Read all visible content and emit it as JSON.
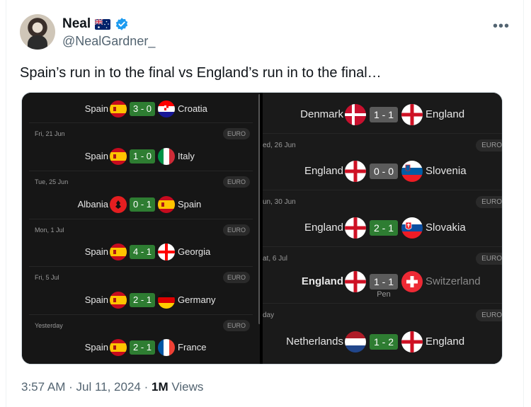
{
  "author": {
    "name": "Neal",
    "handle": "@NealGardner_",
    "flag_icon": "australia-flag-icon",
    "verified_icon": "verified-badge-icon"
  },
  "tweet": {
    "text": "Spain’s run in to the final vs England’s run in to the final…",
    "time": "3:57 AM",
    "date": "Jul 11, 2024",
    "views_count": "1M",
    "views_label": "Views"
  },
  "left_panel": {
    "matches": [
      {
        "home": "Spain",
        "score": "3 - 0",
        "away": "Croatia"
      },
      {
        "date": "Fri, 21 Jun",
        "tag": "EURO",
        "home": "Spain",
        "score": "1 - 0",
        "away": "Italy"
      },
      {
        "date": "Tue, 25 Jun",
        "tag": "EURO",
        "home": "Albania",
        "score": "0 - 1",
        "away": "Spain"
      },
      {
        "date": "Mon, 1 Jul",
        "tag": "EURO",
        "home": "Spain",
        "score": "4 - 1",
        "away": "Georgia"
      },
      {
        "date": "Fri, 5 Jul",
        "tag": "EURO",
        "home": "Spain",
        "score": "2 - 1",
        "away": "Germany"
      },
      {
        "date": "Yesterday",
        "tag": "EURO",
        "home": "Spain",
        "score": "2 - 1",
        "away": "France"
      }
    ]
  },
  "right_panel": {
    "matches": [
      {
        "home": "Denmark",
        "score": "1 - 1",
        "away": "England"
      },
      {
        "date": "ed, 26 Jun",
        "tag": "EURO",
        "home": "England",
        "score": "0 - 0",
        "away": "Slovenia"
      },
      {
        "date": "un, 30 Jun",
        "tag": "EURO",
        "home": "England",
        "score": "2 - 1",
        "away": "Slovakia"
      },
      {
        "date": "at, 6 Jul",
        "tag": "EURO",
        "home": "England",
        "score": "1 - 1",
        "away": "Switzerland",
        "note": "Pen"
      },
      {
        "date": "day",
        "tag": "EURO",
        "home": "Netherlands",
        "score": "1 - 2",
        "away": "England"
      }
    ]
  },
  "colors": {
    "win_score": "#2e7d32",
    "draw_score": "#5b5b5b",
    "panel_bg": "#161616"
  }
}
